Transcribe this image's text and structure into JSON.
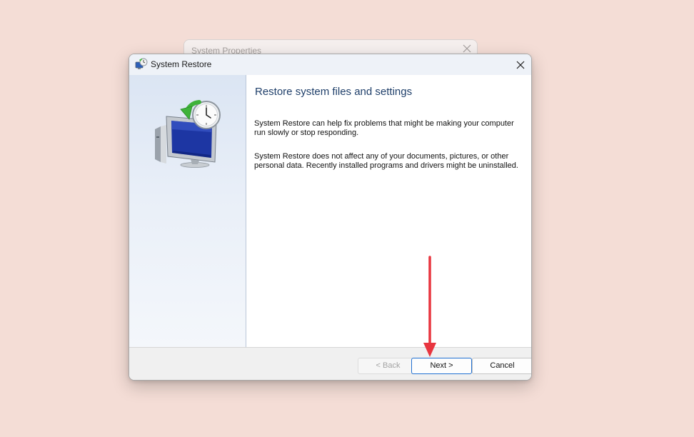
{
  "background_window": {
    "title": "System Properties",
    "close_icon": "close-icon"
  },
  "dialog": {
    "title": "System Restore",
    "title_icon": "system-restore-icon",
    "close_icon": "close-icon",
    "heading": "Restore system files and settings",
    "paragraph_1": "System Restore can help fix problems that might be making your computer run slowly or stop responding.",
    "paragraph_2": "System Restore does not affect any of your documents, pictures, or other personal data. Recently installed programs and drivers might be uninstalled.",
    "hero_icon": "system-restore-computer-clock-icon",
    "buttons": {
      "back_label": "< Back",
      "back_enabled": false,
      "next_label": "Next >",
      "cancel_label": "Cancel"
    }
  },
  "annotation": {
    "arrow_icon": "red-arrow-down-icon",
    "arrow_color": "#e8353f"
  },
  "colors": {
    "desktop_background": "#f4ddd6",
    "heading_text": "#1f3f6a",
    "focus_border": "#1f6fd0",
    "sidebar_gradient_top": "#dbe5f3"
  }
}
